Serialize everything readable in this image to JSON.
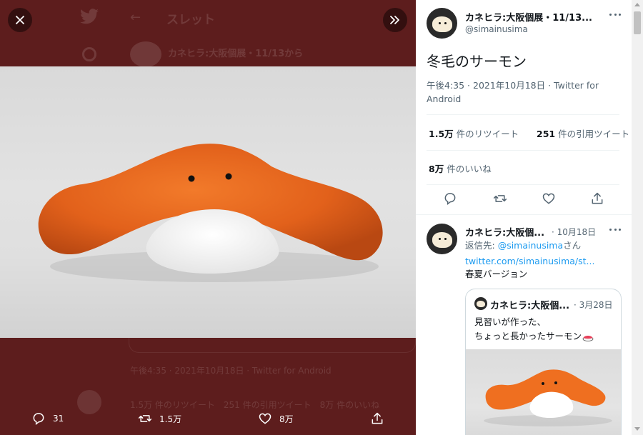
{
  "background_thread": {
    "header_title": "スレット",
    "author_name": "カネヒラ:大阪個展・11/13から",
    "meta_text": "午後4:35 · 2021年10月18日 · Twitter for Android",
    "stats_text": "1.5万 件のリツイート　251 件の引用ツイート　8万 件のいいね"
  },
  "media_actions": {
    "reply_count": "31",
    "retweet_count": "1.5万",
    "like_count": "8万"
  },
  "tweet": {
    "author_name": "カネヒラ:大阪個展・11/13...",
    "author_handle": "@simainusima",
    "text": "冬毛のサーモン",
    "meta": "午後4:35 · 2021年10月18日 · Twitter for Android",
    "retweets_value": "1.5万",
    "retweets_label": "件のリツイート",
    "quotes_value": "251",
    "quotes_label": "件の引用ツイート",
    "likes_value": "8万",
    "likes_label": "件のいいね"
  },
  "reply": {
    "author_name": "カネヒラ:大阪個...",
    "date": "· 10月18日",
    "replying_to_prefix": "返信先: ",
    "replying_to_handle": "@simainusima",
    "replying_to_suffix": "さん",
    "link": "twitter.com/simainusima/st...",
    "text": "春夏バージョン"
  },
  "quoted": {
    "author_name": "カネヒラ:大阪個...",
    "date": "· 3月28日",
    "line1": "見習いが作った、",
    "line2": "ちょっと長かったサーモン"
  },
  "icons": {
    "close": "close-icon",
    "expand": "chevron-double-right-icon",
    "reply": "comment-icon",
    "retweet": "retweet-icon",
    "like": "heart-icon",
    "share": "share-icon",
    "more": "more-dots-icon",
    "sushi_emoji": "sushi-icon"
  },
  "colors": {
    "link": "#1d9bf0",
    "overlay": "#5d1d1d",
    "plush_orange": "#e8641c"
  }
}
